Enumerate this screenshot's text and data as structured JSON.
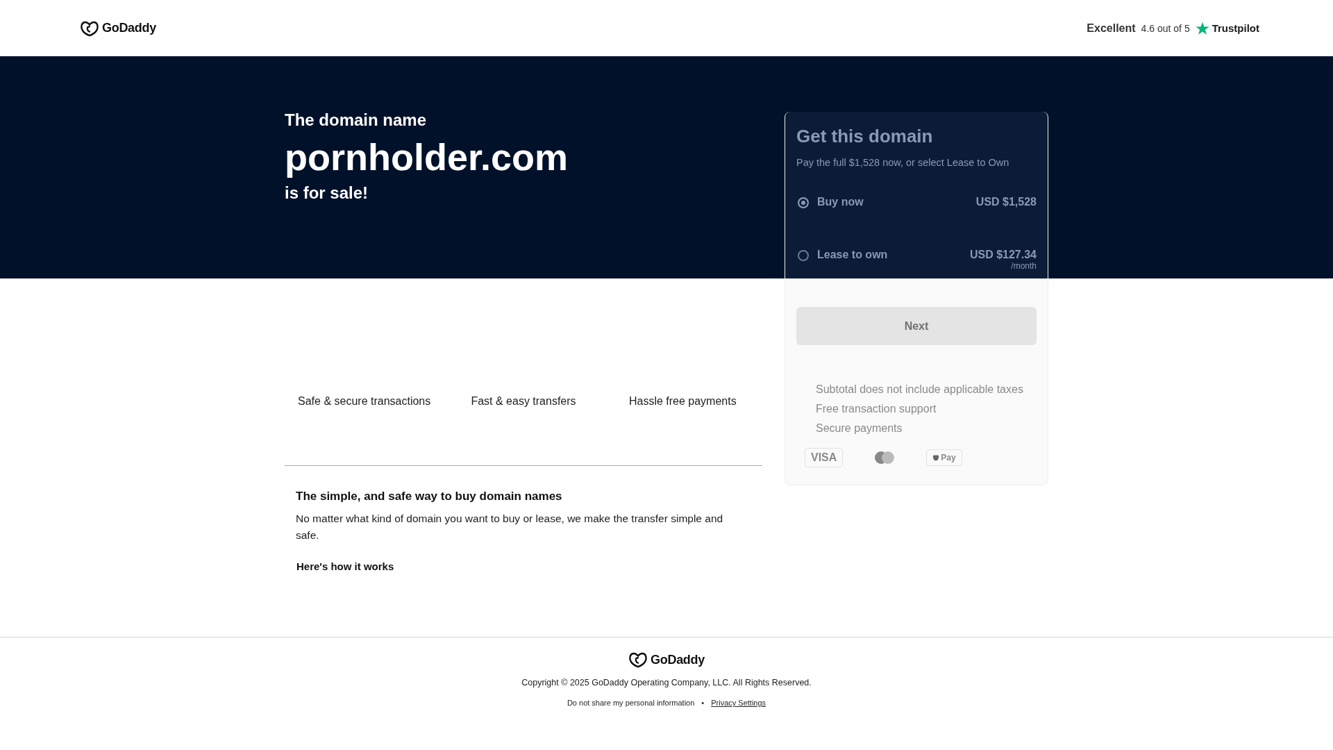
{
  "header": {
    "logo": "GoDaddy",
    "rating": {
      "label": "Excellent",
      "score": "4.6 out of 5",
      "brand": "Trustpilot"
    }
  },
  "hero": {
    "intro": "The domain name",
    "domain": "pornholder.com",
    "outro": "is for sale!"
  },
  "purchase_card": {
    "title": "Get this domain",
    "subtitle": "Pay the full $1,528 now, or select Lease to Own",
    "options": [
      {
        "label": "Buy now",
        "price": "USD $1,528",
        "selected": true
      },
      {
        "label": "Lease to own",
        "price": "USD $127.34",
        "note": "/month",
        "selected": false
      }
    ],
    "button": "Next",
    "notes": [
      "Subtotal does not include applicable taxes",
      "Free transaction support",
      "Secure payments"
    ],
    "payment_methods": [
      {
        "kind": "visa",
        "label": "VISA"
      },
      {
        "kind": "mastercard"
      },
      {
        "kind": "applepay",
        "label": "Pay"
      }
    ]
  },
  "features": [
    "Safe & secure transactions",
    "Fast & easy transfers",
    "Hassle free payments"
  ],
  "info": {
    "title": "The simple, and safe way to buy domain names",
    "text": "No matter what kind of domain you want to buy or lease, we make the transfer simple and safe.",
    "link": "Here's how it works"
  },
  "footer": {
    "logo": "GoDaddy",
    "copyright": "Copyright © 2025 GoDaddy Operating Company, LLC. All Rights Reserved.",
    "links": [
      "Do not share my personal information",
      "Privacy Settings"
    ],
    "separator": "•"
  }
}
